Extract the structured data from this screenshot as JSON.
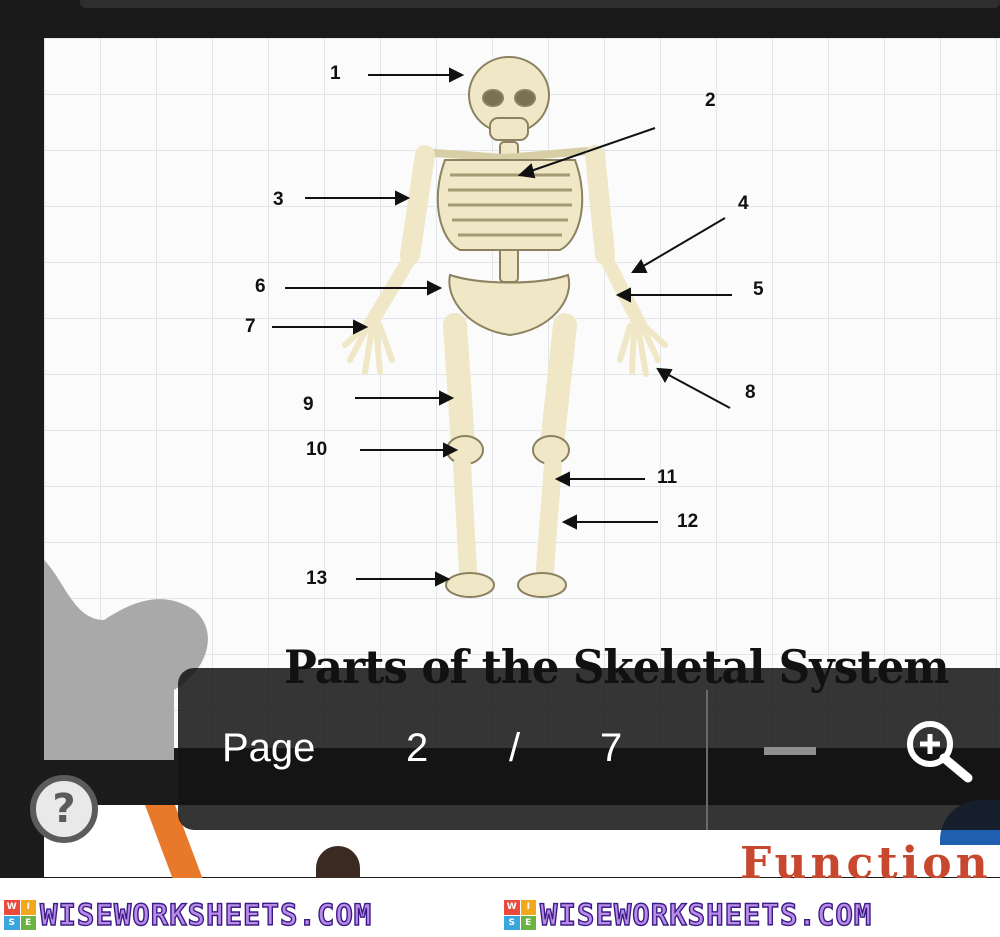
{
  "document": {
    "caption": "Parts of the Skeletal System",
    "labels": [
      "1",
      "2",
      "3",
      "4",
      "5",
      "6",
      "7",
      "8",
      "9",
      "10",
      "11",
      "12",
      "13"
    ]
  },
  "viewer": {
    "page_label": "Page",
    "current_page": "2",
    "separator": "/",
    "total_pages": "7"
  },
  "icons": {
    "zoom_in": "zoom-in-icon",
    "zoom_out": "zoom-out-icon",
    "help": "help-icon"
  },
  "background": {
    "partial_text": "Function"
  },
  "help_glyph": "?",
  "watermark": {
    "text": "WISEWORKSHEETS.COM",
    "logo_letters": [
      "W",
      "I",
      "S",
      "E"
    ]
  },
  "colors": {
    "bone": "#efe7c6",
    "bone_shadow": "#c9bd8e",
    "toolbar": "#141414",
    "watermark_fill": "#b98ce8",
    "watermark_stroke": "#3b1b86"
  }
}
